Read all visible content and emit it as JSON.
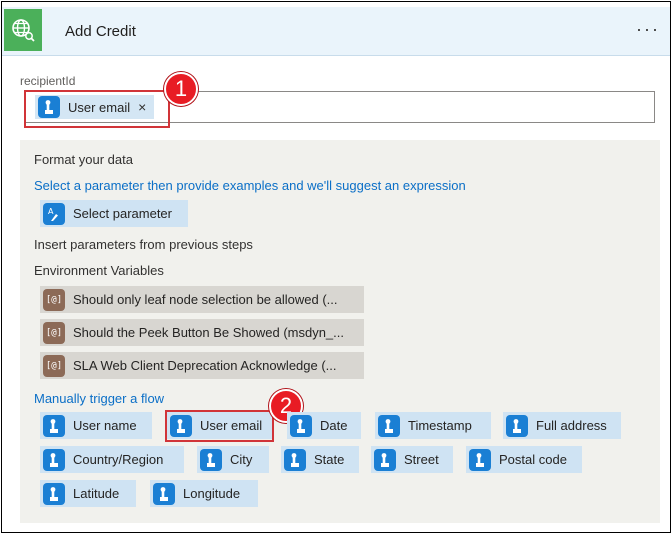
{
  "header": {
    "title": "Add Credit",
    "more_label": "···",
    "icon": "globe-search-icon",
    "color": "#4bb05a"
  },
  "recipient": {
    "label": "recipientId",
    "token_label": "User email",
    "token_remove": "×",
    "token_icon": "user-touch-icon"
  },
  "callouts": [
    "1",
    "2"
  ],
  "panel": {
    "format_heading": "Format your data",
    "format_link": "Select a parameter then provide examples and we'll suggest an expression",
    "select_parameter": "Select parameter",
    "insert_heading": "Insert parameters from previous steps",
    "env_heading": "Environment Variables",
    "env_items": [
      "Should only leaf node selection be allowed (...",
      "Should the Peek Button Be Showed (msdyn_...",
      "SLA Web Client Deprecation Acknowledge (..."
    ],
    "env_icon_text": "[@]",
    "trigger_heading": "Manually trigger a flow",
    "trigger_items": [
      "User name",
      "User email",
      "Date",
      "Timestamp",
      "Full address",
      "Country/Region",
      "City",
      "State",
      "Street",
      "Postal code",
      "Latitude",
      "Longitude"
    ]
  },
  "colors": {
    "accent": "#1a7fd4",
    "link": "#0b6fc7",
    "highlight": "#d13438",
    "callout": "#e81c24"
  }
}
